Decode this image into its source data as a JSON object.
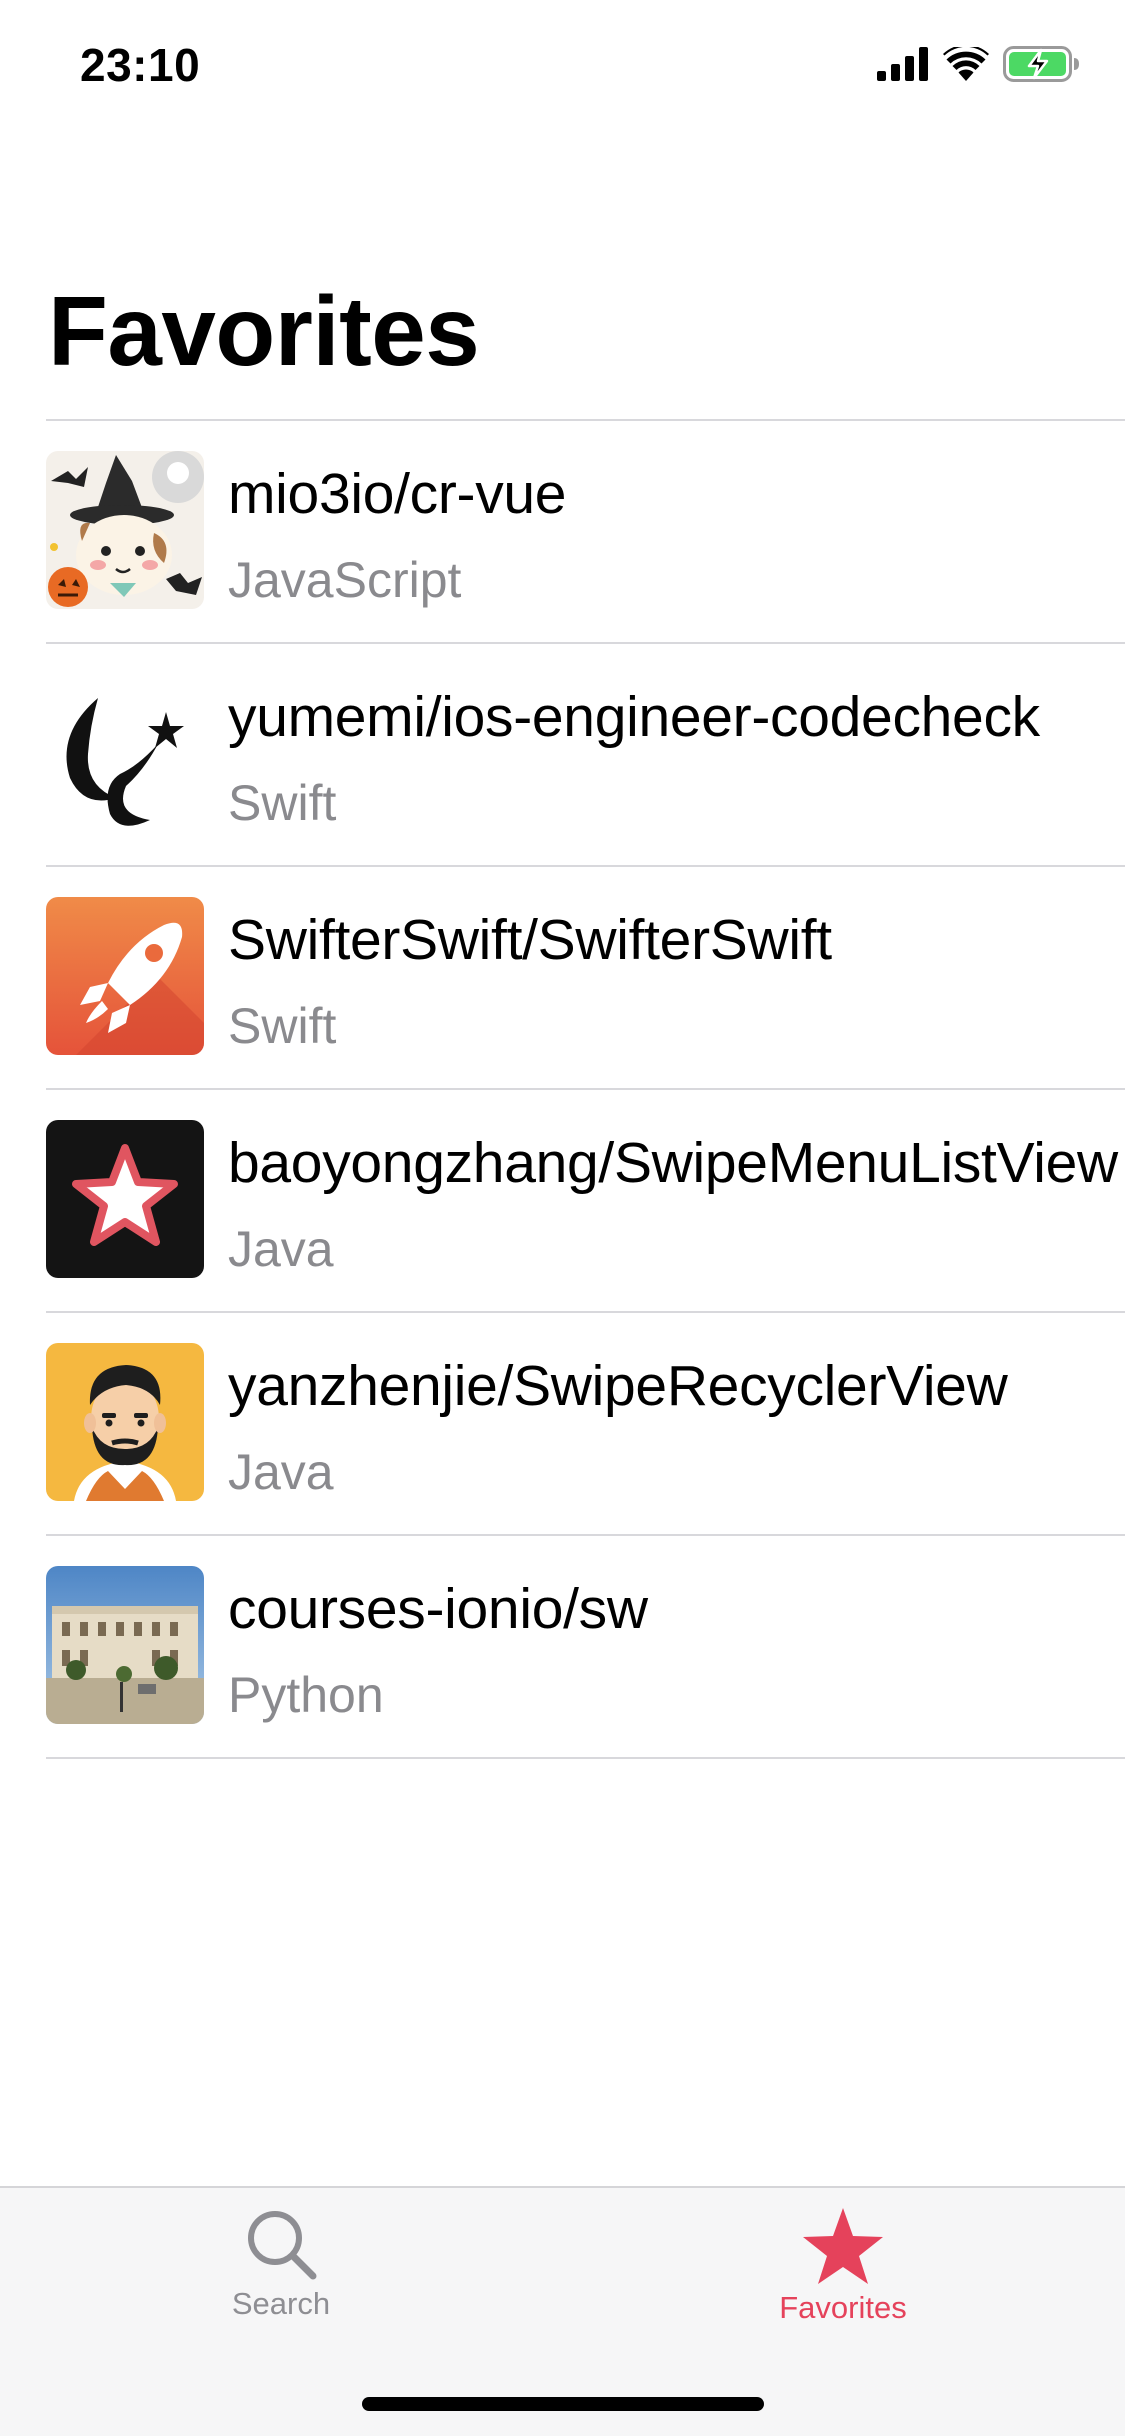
{
  "status_bar": {
    "time": "23:10",
    "icons": [
      "cellular-signal-icon",
      "wifi-icon",
      "battery-charging-icon"
    ]
  },
  "header": {
    "title": "Favorites"
  },
  "repositories": [
    {
      "name": "mio3io/cr-vue",
      "language": "JavaScript",
      "avatar_icon": "halloween-cat-avatar"
    },
    {
      "name": "yumemi/ios-engineer-codecheck",
      "language": "Swift",
      "avatar_icon": "yumemi-logo-avatar"
    },
    {
      "name": "SwifterSwift/SwifterSwift",
      "language": "Swift",
      "avatar_icon": "rocket-avatar"
    },
    {
      "name": "baoyongzhang/SwipeMenuListView",
      "language": "Java",
      "avatar_icon": "star-avatar"
    },
    {
      "name": "yanzhenjie/SwipeRecyclerView",
      "language": "Java",
      "avatar_icon": "bearded-man-avatar"
    },
    {
      "name": "courses-ionio/sw",
      "language": "Python",
      "avatar_icon": "building-photo-avatar"
    }
  ],
  "tab_bar": {
    "tabs": [
      {
        "label": "Search",
        "icon": "search-icon",
        "selected": false
      },
      {
        "label": "Favorites",
        "icon": "star-icon",
        "selected": true
      }
    ]
  },
  "colors": {
    "accent": "#e5425b",
    "secondary_text": "#8a8a8e",
    "tab_inactive": "#8e8e93",
    "separator": "#d8d8dc"
  }
}
